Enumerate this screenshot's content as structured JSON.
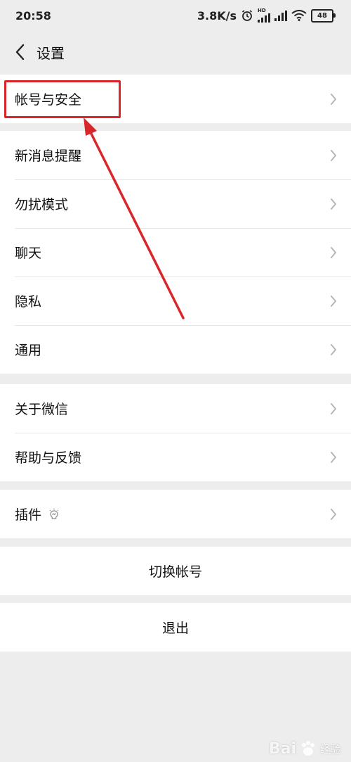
{
  "status_bar": {
    "time": "20:58",
    "net_speed": "3.8K/s",
    "battery": "48",
    "hd_label": "HD"
  },
  "nav": {
    "title": "设置"
  },
  "groups": [
    {
      "items": [
        {
          "label": "帐号与安全"
        }
      ]
    },
    {
      "items": [
        {
          "label": "新消息提醒"
        },
        {
          "label": "勿扰模式"
        },
        {
          "label": "聊天"
        },
        {
          "label": "隐私"
        },
        {
          "label": "通用"
        }
      ]
    },
    {
      "items": [
        {
          "label": "关于微信"
        },
        {
          "label": "帮助与反馈"
        }
      ]
    },
    {
      "items": [
        {
          "label": "插件"
        }
      ]
    }
  ],
  "actions": {
    "switch_account": "切换帐号",
    "logout": "退出"
  },
  "watermark": {
    "brand": "Bai",
    "brand_suffix": "经验"
  },
  "colors": {
    "background": "#ededed",
    "annotation_red": "#d9262a"
  },
  "icons": {
    "back": "chevron-left-icon",
    "row_arrow": "chevron-right-icon",
    "plugin_badge": "plugin-bulb-icon"
  }
}
